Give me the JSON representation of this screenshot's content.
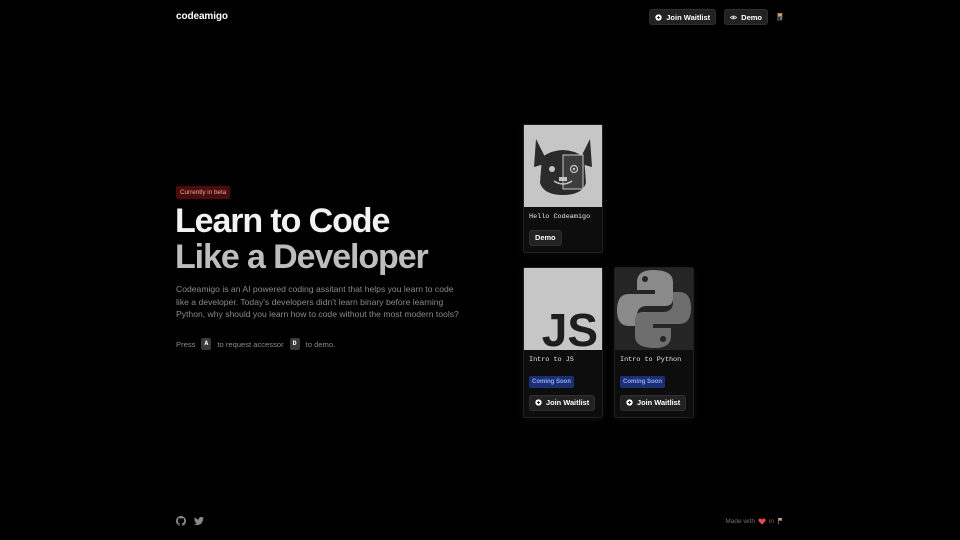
{
  "header": {
    "brand": "codeamigo",
    "join_waitlist_label": "Join Waitlist",
    "demo_label": "Demo"
  },
  "hero": {
    "beta_badge": "Currently in beta",
    "headline_line1": "Learn to Code",
    "headline_line2": "Like a Developer",
    "description": "Codeamigo is an AI powered coding assitant that helps you learn to code like a developer. Today's developers didn't learn binary before learning Python, why should you learn how to code without the most modern tools?",
    "press_label": "Press",
    "key_a": "A",
    "key_a_text": "to request accessor",
    "key_d": "D",
    "key_d_text": "to demo."
  },
  "cards": [
    {
      "title": "Hello Codeamigo",
      "button": "Demo",
      "icon": "bulldog-robot-logo"
    },
    {
      "title": "Intro to JS",
      "status": "Coming Soon",
      "button": "Join Waitlist",
      "icon": "js-logo",
      "logo_text": "JS"
    },
    {
      "title": "Intro to Python",
      "status": "Coming Soon",
      "button": "Join Waitlist",
      "icon": "python-logo"
    }
  ],
  "footer": {
    "made_with": "Made with",
    "in_text": "in",
    "icons": [
      "github-icon",
      "twitter-icon",
      "heart-icon",
      "flag-icon"
    ]
  },
  "colors": {
    "background": "#000000",
    "beta_badge_bg": "#4a0d0d",
    "beta_badge_text": "#f1a3a3",
    "coming_soon_bg": "#1c2f73",
    "coming_soon_text": "#90a8f4",
    "heart": "#e5484d"
  }
}
